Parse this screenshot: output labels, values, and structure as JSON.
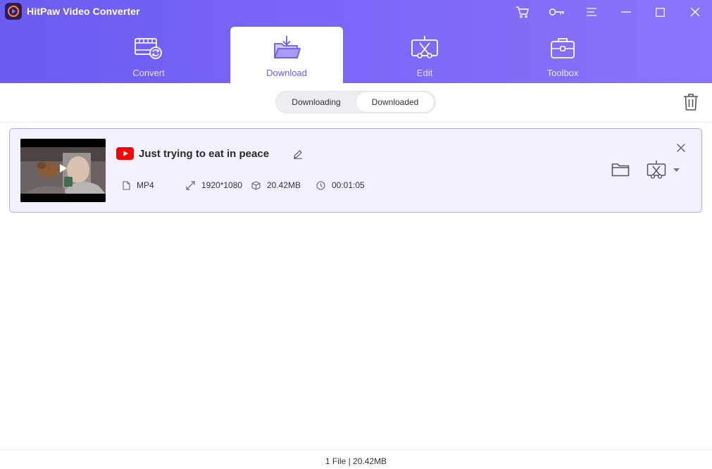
{
  "app": {
    "title": "HitPaw Video Converter"
  },
  "window_controls": [
    {
      "name": "cart-icon"
    },
    {
      "name": "key-icon"
    },
    {
      "name": "menu-icon"
    },
    {
      "name": "minimize-icon"
    },
    {
      "name": "maximize-icon"
    },
    {
      "name": "close-icon"
    }
  ],
  "tabs": [
    {
      "label": "Convert",
      "icon": "film-convert-icon"
    },
    {
      "label": "Download",
      "icon": "download-folder-icon",
      "active": true
    },
    {
      "label": "Edit",
      "icon": "scissors-edit-icon"
    },
    {
      "label": "Toolbox",
      "icon": "toolbox-icon"
    }
  ],
  "sub_tabs": {
    "downloading": "Downloading",
    "downloaded": "Downloaded",
    "selected": "Downloaded"
  },
  "items": [
    {
      "title": "Just trying to eat in peace",
      "source": "youtube-icon",
      "format": "MP4",
      "resolution": "1920*1080",
      "size": "20.42MB",
      "duration": "00:01:05"
    }
  ],
  "status": {
    "summary": "1 File | 20.42MB"
  },
  "colors": {
    "accent": "#6a5cf0",
    "accent_light": "#8b74fb",
    "card_bg": "#f2f1fd",
    "card_border": "#b5acf1",
    "youtube_red": "#ff0000"
  }
}
